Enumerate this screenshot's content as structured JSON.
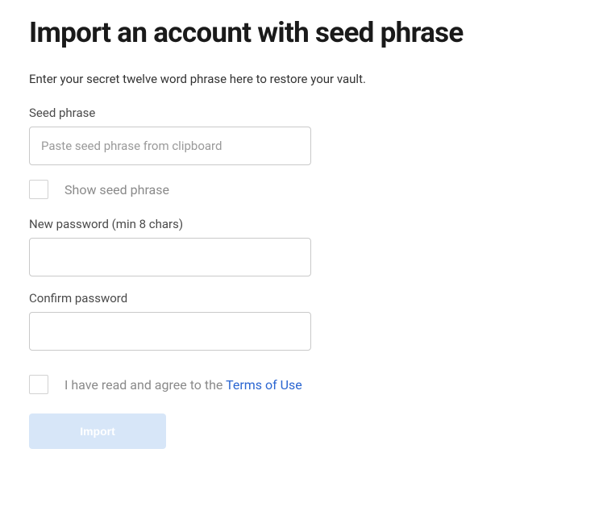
{
  "title": "Import an account with seed phrase",
  "subtitle": "Enter your secret twelve word phrase here to restore your vault.",
  "seed_phrase": {
    "label": "Seed phrase",
    "placeholder": "Paste seed phrase from clipboard",
    "value": "",
    "show_label": "Show seed phrase",
    "show_checked": false
  },
  "new_password": {
    "label": "New password (min 8 chars)",
    "value": ""
  },
  "confirm_password": {
    "label": "Confirm password",
    "value": ""
  },
  "terms": {
    "text_prefix": "I have read and agree to the ",
    "link_text": "Terms of Use",
    "checked": false
  },
  "import_button": "Import",
  "colors": {
    "link": "#2b66d1",
    "button_disabled": "#d7e6f8"
  }
}
